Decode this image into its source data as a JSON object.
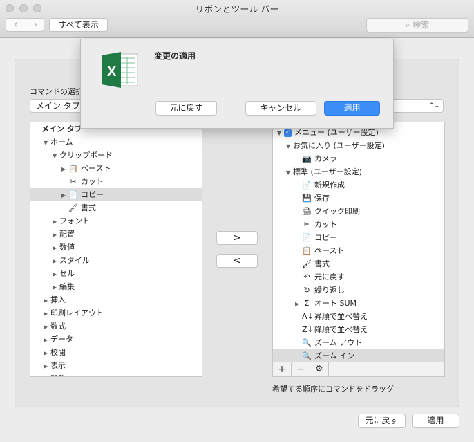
{
  "window": {
    "title": "リボンとツール バー"
  },
  "toolbar": {
    "back_icon": "chevron-left-icon",
    "forward_icon": "chevron-right-icon",
    "show_all": "すべて表示",
    "search_placeholder": "検索",
    "search_icon": "search-icon"
  },
  "dialog": {
    "title": "変更の適用",
    "revert": "元に戻す",
    "cancel": "キャンセル",
    "apply": "適用",
    "app_icon": "excel-icon"
  },
  "left": {
    "commands_label": "コマンドの選択",
    "dropdown_value": "メイン タブ",
    "items": [
      {
        "label": "メイン タブ",
        "indent": 0,
        "tri": "",
        "bold": true
      },
      {
        "label": "ホーム",
        "indent": 1,
        "tri": "▼"
      },
      {
        "label": "クリップボード",
        "indent": 2,
        "tri": "▼"
      },
      {
        "label": "ペースト",
        "indent": 3,
        "tri": "▶",
        "icon": "📋",
        "submenu": true
      },
      {
        "label": "カット",
        "indent": 3,
        "tri": "",
        "icon": "✂"
      },
      {
        "label": "コピー",
        "indent": 3,
        "tri": "▶",
        "icon": "📄",
        "submenu": true,
        "selected": true
      },
      {
        "label": "書式",
        "indent": 3,
        "tri": "",
        "icon": "🖌"
      },
      {
        "label": "フォント",
        "indent": 2,
        "tri": "▶"
      },
      {
        "label": "配置",
        "indent": 2,
        "tri": "▶"
      },
      {
        "label": "数値",
        "indent": 2,
        "tri": "▶"
      },
      {
        "label": "スタイル",
        "indent": 2,
        "tri": "▶"
      },
      {
        "label": "セル",
        "indent": 2,
        "tri": "▶"
      },
      {
        "label": "編集",
        "indent": 2,
        "tri": "▶"
      },
      {
        "label": "挿入",
        "indent": 1,
        "tri": "▶"
      },
      {
        "label": "印刷レイアウト",
        "indent": 1,
        "tri": "▶"
      },
      {
        "label": "数式",
        "indent": 1,
        "tri": "▶"
      },
      {
        "label": "データ",
        "indent": 1,
        "tri": "▶"
      },
      {
        "label": "校閲",
        "indent": 1,
        "tri": "▶"
      },
      {
        "label": "表示",
        "indent": 1,
        "tri": "▶"
      },
      {
        "label": "開発",
        "indent": 1,
        "tri": "▶"
      }
    ]
  },
  "middle": {
    "add_label": ">",
    "remove_label": "<"
  },
  "right": {
    "items": [
      {
        "label": "メニュー (ユーザー設定)",
        "indent": 0,
        "tri": "▼",
        "checkbox": true
      },
      {
        "label": "お気に入り (ユーザー設定)",
        "indent": 1,
        "tri": "▼"
      },
      {
        "label": "カメラ",
        "indent": 2,
        "tri": "",
        "icon": "📷"
      },
      {
        "label": "標準 (ユーザー設定)",
        "indent": 1,
        "tri": "▼"
      },
      {
        "label": "新規作成",
        "indent": 2,
        "tri": "",
        "icon": "📄"
      },
      {
        "label": "保存",
        "indent": 2,
        "tri": "",
        "icon": "💾"
      },
      {
        "label": "クイック印刷",
        "indent": 2,
        "tri": "",
        "icon": "🖨"
      },
      {
        "label": "カット",
        "indent": 2,
        "tri": "",
        "icon": "✂"
      },
      {
        "label": "コピー",
        "indent": 2,
        "tri": "",
        "icon": "📄"
      },
      {
        "label": "ペースト",
        "indent": 2,
        "tri": "",
        "icon": "📋"
      },
      {
        "label": "書式",
        "indent": 2,
        "tri": "",
        "icon": "🖌"
      },
      {
        "label": "元に戻す",
        "indent": 2,
        "tri": "",
        "icon": "↶",
        "submenu": true
      },
      {
        "label": "繰り返し",
        "indent": 2,
        "tri": "",
        "icon": "↻"
      },
      {
        "label": "オート SUM",
        "indent": 2,
        "tri": "▶",
        "icon": "Σ",
        "submenu": true
      },
      {
        "label": "昇順で並べ替え",
        "indent": 2,
        "tri": "",
        "icon": "A↓"
      },
      {
        "label": "降順で並べ替え",
        "indent": 2,
        "tri": "",
        "icon": "Z↓"
      },
      {
        "label": "ズーム アウト",
        "indent": 2,
        "tri": "",
        "icon": "🔍"
      },
      {
        "label": "ズーム イン",
        "indent": 2,
        "tri": "",
        "icon": "🔍",
        "selected": true
      }
    ],
    "footer": {
      "add": "+",
      "remove": "−",
      "settings_icon": "gear-icon"
    },
    "hint": "希望する順序にコマンドをドラッグ"
  },
  "bottom": {
    "revert": "元に戻す",
    "apply": "適用"
  }
}
